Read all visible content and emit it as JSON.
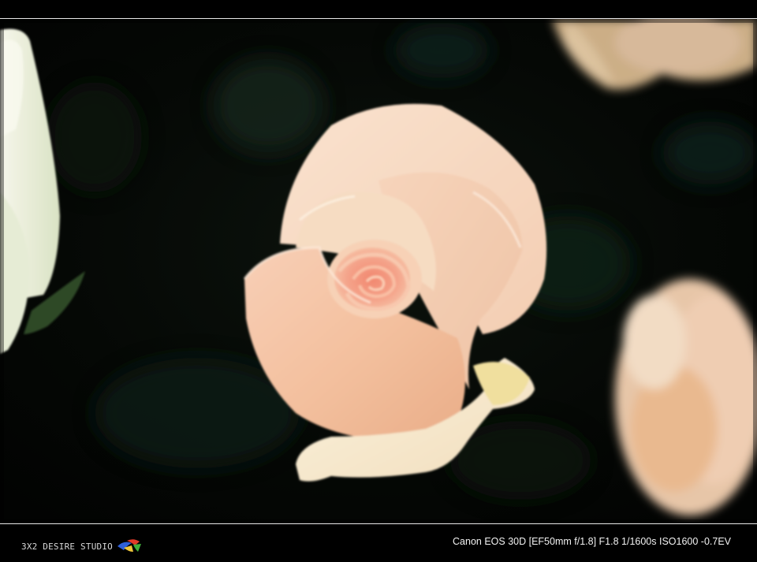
{
  "watermark": {
    "studio_name": "3X2 DESIRE STUDIO",
    "logo_icon": "studio-logo-icon"
  },
  "exif": {
    "text": "Canon EOS 30D [EF50mm f/1.8] F1.8 1/1600s ISO1600 -0.7EV"
  },
  "colors": {
    "background": "#000000",
    "rule": "#e8e8e8",
    "rose_peach": "#f4c6a8",
    "rose_center": "#f08f78",
    "rose_highlight": "#fbe9cf",
    "foliage_dark": "#0d1a10"
  }
}
